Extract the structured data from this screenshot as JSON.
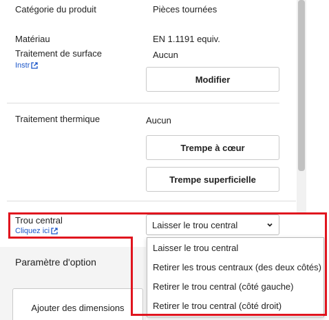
{
  "rows": {
    "category": {
      "label": "Catégorie du produit",
      "value": "Pièces tournées"
    },
    "material": {
      "label": "Matériau",
      "value": "EN 1.1191 equiv."
    },
    "surface": {
      "label": "Traitement de surface",
      "link": "Instr",
      "value": "Aucun",
      "button": "Modifier"
    },
    "thermal": {
      "label": "Traitement thermique",
      "value": "Aucun",
      "button1": "Trempe à cœur",
      "button2": "Trempe superficielle"
    },
    "central_hole": {
      "label": "Trou central",
      "link": "Cliquez ici",
      "selected": "Laisser le trou central",
      "options": [
        "Laisser le trou central",
        "Retirer les trous centraux (des deux côtés)",
        "Retirer le trou central (côté gauche)",
        "Retirer le trou central (côté droit)"
      ]
    }
  },
  "option_section": {
    "title": "Paramètre d'option",
    "add_dimensions": "Ajouter des dimensions"
  },
  "colors": {
    "highlight": "#e0141e",
    "link": "#1b56c9"
  },
  "icons": {
    "external_link": "external-link-icon",
    "chevron": "chevron-down-icon"
  }
}
